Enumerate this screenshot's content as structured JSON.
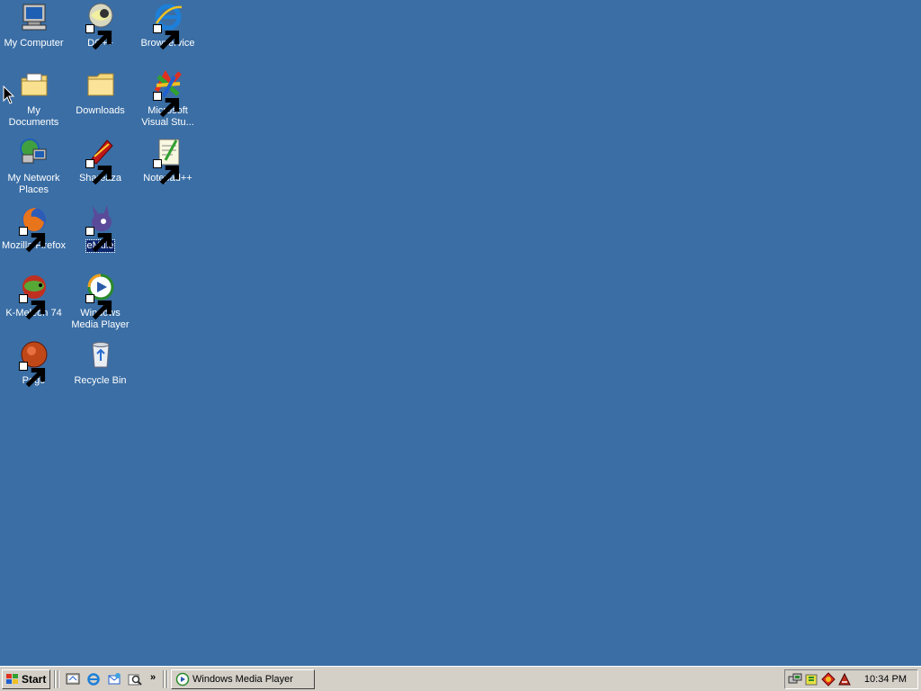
{
  "desktop": {
    "background": "#3a6ea5",
    "icons": [
      {
        "id": "my-computer",
        "label": "My Computer",
        "shortcut": false
      },
      {
        "id": "dcpp",
        "label": "DC++",
        "shortcut": true
      },
      {
        "id": "browservice",
        "label": "Browservice",
        "shortcut": true
      },
      {
        "id": "my-documents",
        "label": "My Documents",
        "shortcut": false
      },
      {
        "id": "downloads",
        "label": "Downloads",
        "shortcut": false
      },
      {
        "id": "msvs",
        "label": "Microsoft Visual Stu...",
        "shortcut": true
      },
      {
        "id": "network",
        "label": "My Network Places",
        "shortcut": false
      },
      {
        "id": "shareaza",
        "label": "Shareaza",
        "shortcut": true
      },
      {
        "id": "notepadpp",
        "label": "Notepad++",
        "shortcut": true
      },
      {
        "id": "firefox",
        "label": "Mozilla Firefox",
        "shortcut": true
      },
      {
        "id": "emule",
        "label": "eMule",
        "shortcut": true,
        "selected": true
      },
      {
        "id": "kmeleon",
        "label": "K-Meleon 74",
        "shortcut": true
      },
      {
        "id": "wmp",
        "label": "Windows Media Player",
        "shortcut": true
      },
      {
        "id": "pego",
        "label": "Pego",
        "shortcut": true
      },
      {
        "id": "recycle",
        "label": "Recycle Bin",
        "shortcut": false
      }
    ]
  },
  "taskbar": {
    "start_label": "Start",
    "quick_launch": [
      "show-desktop-icon",
      "internet-explorer-icon",
      "outlook-express-icon",
      "search-icon"
    ],
    "overflow": "»",
    "task_button_label": "Windows Media Player",
    "tray_icons": [
      "network-icon",
      "volume-icon",
      "antivirus-icon",
      "emule-tray-icon"
    ],
    "clock": "10:34 PM"
  }
}
